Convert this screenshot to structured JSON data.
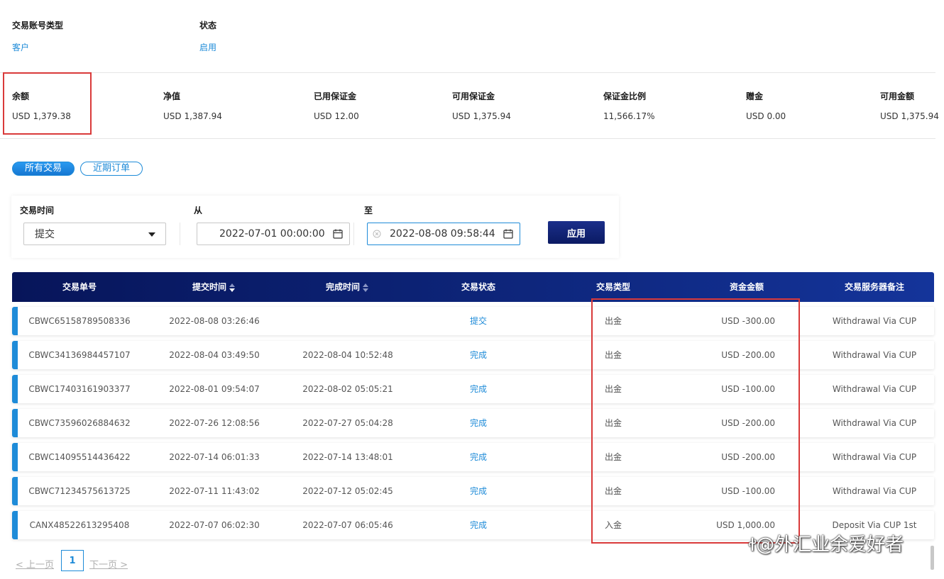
{
  "account": {
    "type_label": "交易账号类型",
    "type_value": "客户",
    "status_label": "状态",
    "status_value": "启用"
  },
  "summary": [
    {
      "label": "余额",
      "value": "USD 1,379.38"
    },
    {
      "label": "净值",
      "value": "USD 1,387.94"
    },
    {
      "label": "已用保证金",
      "value": "USD 12.00"
    },
    {
      "label": "可用保证金",
      "value": "USD 1,375.94"
    },
    {
      "label": "保证金比例",
      "value": "11,566.17%"
    },
    {
      "label": "赠金",
      "value": "USD 0.00"
    },
    {
      "label": "可用金额",
      "value": "USD 1,375.94"
    }
  ],
  "tabs": {
    "all": "所有交易",
    "recent": "近期订单"
  },
  "filter": {
    "time_label": "交易时间",
    "time_select": "提交",
    "from_label": "从",
    "from_value": "2022-07-01 00:00:00",
    "to_label": "至",
    "to_value": "2022-08-08 09:58:44",
    "apply": "应用"
  },
  "table": {
    "headers": [
      "交易单号",
      "提交时间",
      "完成时间",
      "交易状态",
      "交易类型",
      "资金金额",
      "交易服务器备注"
    ],
    "rows": [
      {
        "id": "CBWC65158789508336",
        "submit": "2022-08-08 03:26:46",
        "complete": "",
        "status": "提交",
        "type": "出金",
        "amount": "USD -300.00",
        "remark": "Withdrawal Via CUP"
      },
      {
        "id": "CBWC34136984457107",
        "submit": "2022-08-04 03:49:50",
        "complete": "2022-08-04 10:52:48",
        "status": "完成",
        "type": "出金",
        "amount": "USD -200.00",
        "remark": "Withdrawal Via CUP"
      },
      {
        "id": "CBWC17403161903377",
        "submit": "2022-08-01 09:54:07",
        "complete": "2022-08-02 05:05:21",
        "status": "完成",
        "type": "出金",
        "amount": "USD -100.00",
        "remark": "Withdrawal Via CUP"
      },
      {
        "id": "CBWC73596026884632",
        "submit": "2022-07-26 12:08:56",
        "complete": "2022-07-27 05:04:28",
        "status": "完成",
        "type": "出金",
        "amount": "USD -200.00",
        "remark": "Withdrawal Via CUP"
      },
      {
        "id": "CBWC14095514436422",
        "submit": "2022-07-14 06:01:33",
        "complete": "2022-07-14 13:48:01",
        "status": "完成",
        "type": "出金",
        "amount": "USD -200.00",
        "remark": "Withdrawal Via CUP"
      },
      {
        "id": "CBWC71234575613725",
        "submit": "2022-07-11 11:43:02",
        "complete": "2022-07-12 05:02:45",
        "status": "完成",
        "type": "出金",
        "amount": "USD -100.00",
        "remark": "Withdrawal Via CUP"
      },
      {
        "id": "CANX48522613295408",
        "submit": "2022-07-07 06:02:30",
        "complete": "2022-07-07 06:05:46",
        "status": "完成",
        "type": "入金",
        "amount": "USD 1,000.00",
        "remark": "Deposit Via CUP 1st"
      }
    ]
  },
  "pager": {
    "prev": "< 上一页",
    "current": "1",
    "next": "下一页 >"
  },
  "watermark": "@外汇业余爱好者",
  "colors": {
    "accent": "#1e8bd8",
    "header_dark": "#0d2478",
    "highlight": "#d93a3a"
  }
}
